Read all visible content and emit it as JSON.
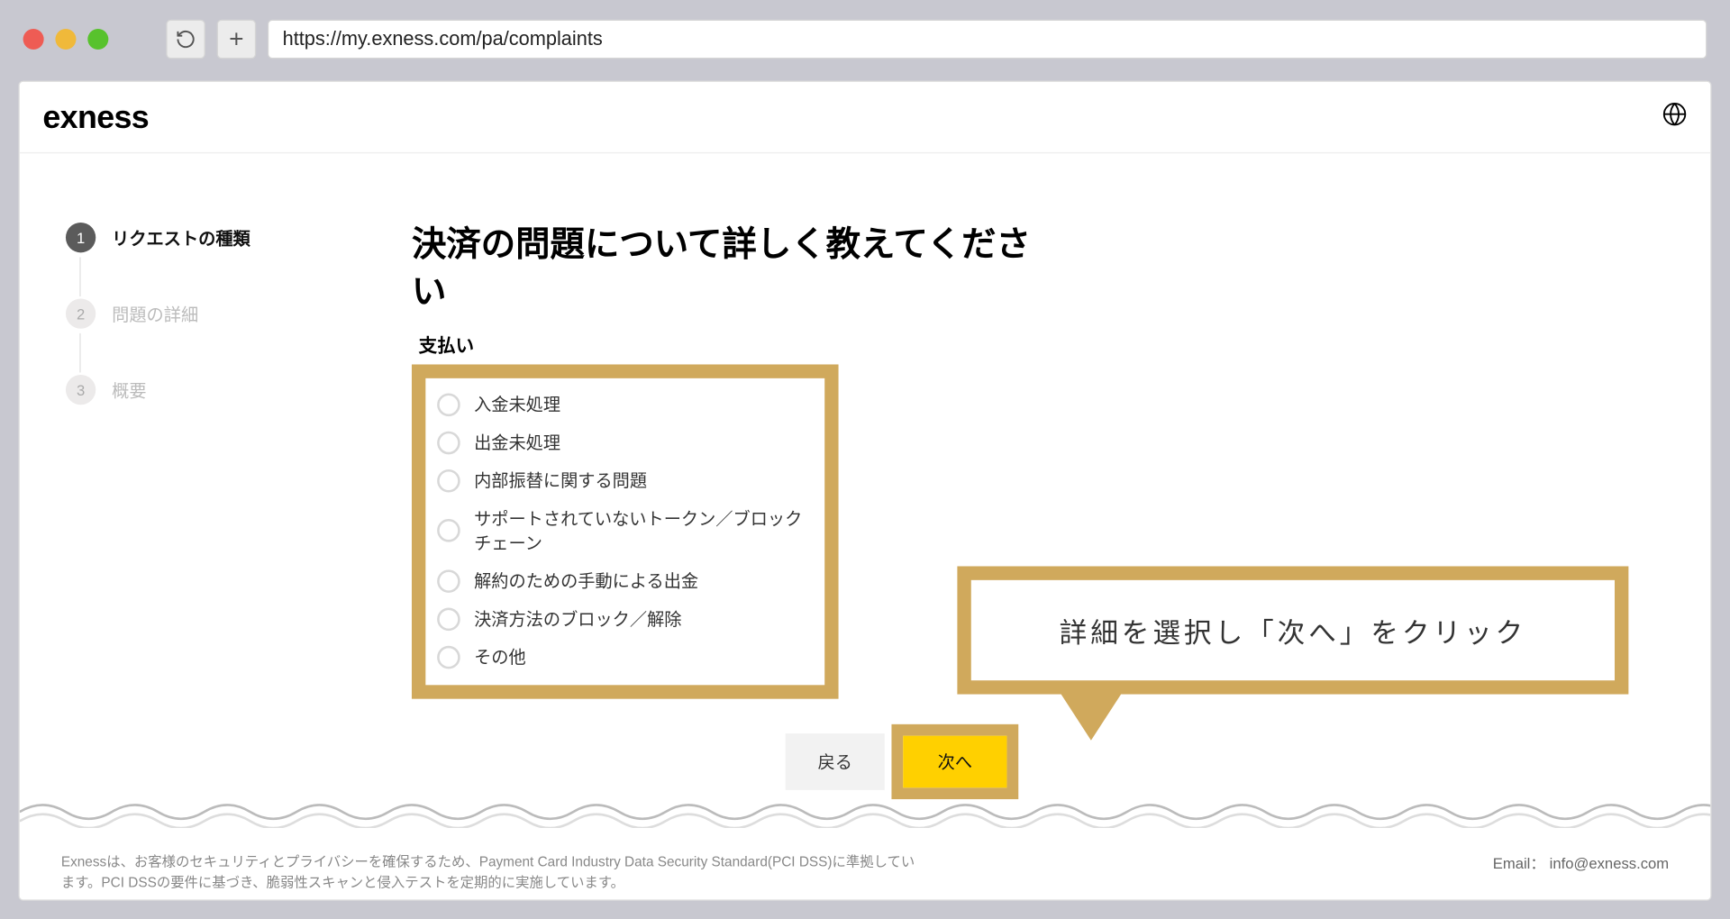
{
  "browser": {
    "url": "https://my.exness.com/pa/complaints"
  },
  "header": {
    "logo": "exness"
  },
  "sidebar": {
    "steps": [
      {
        "num": "1",
        "label": "リクエストの種類",
        "state": "active"
      },
      {
        "num": "2",
        "label": "問題の詳細",
        "state": "inactive"
      },
      {
        "num": "3",
        "label": "概要",
        "state": "inactive"
      }
    ]
  },
  "main": {
    "title": "決済の問題について詳しく教えてください",
    "section_label": "支払い",
    "options": [
      "入金未処理",
      "出金未処理",
      "内部振替に関する問題",
      "サポートされていないトークン／ブロックチェーン",
      "解約のための手動による出金",
      "決済方法のブロック／解除",
      "その他"
    ],
    "back_label": "戻る",
    "next_label": "次へ"
  },
  "callout": {
    "text": "詳細を選択し「次へ」をクリック"
  },
  "footer": {
    "disclaimer": "Exnessは、お客様のセキュリティとプライバシーを確保するため、Payment Card Industry Data Security Standard(PCI DSS)に準拠しています。PCI DSSの要件に基づき、脆弱性スキャンと侵入テストを定期的に実施しています。",
    "email_label": "Email：",
    "email_value": "info@exness.com"
  }
}
